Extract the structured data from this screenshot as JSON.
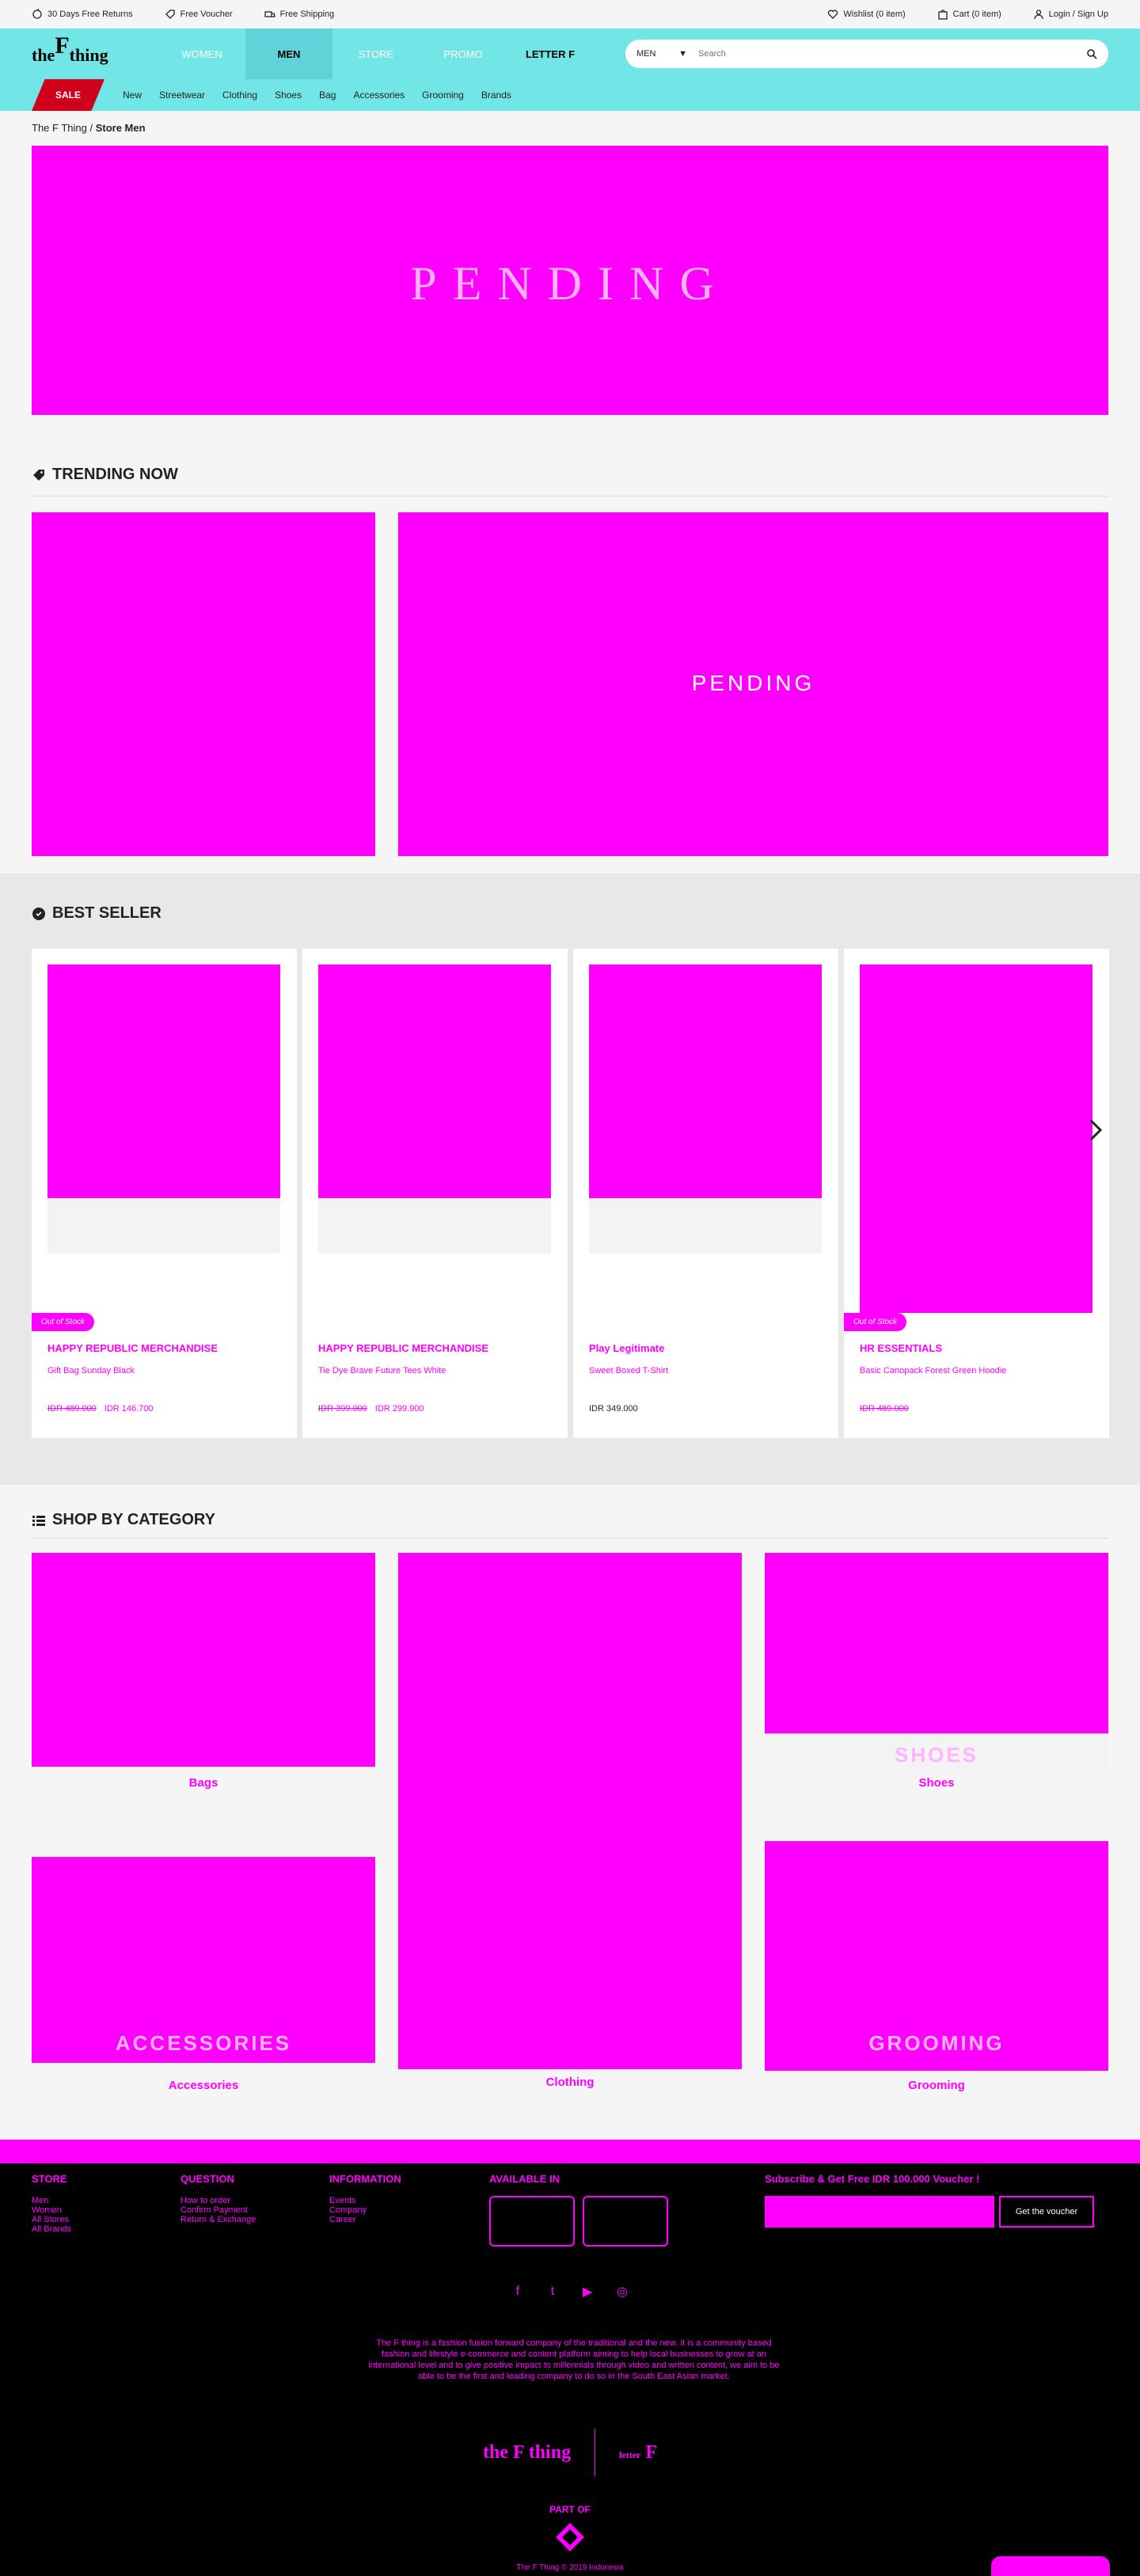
{
  "topbar": {
    "returns": "30 Days Free Returns",
    "voucher": "Free Voucher",
    "shipping": "Free Shipping",
    "wishlist": "Wishlist (0 item)",
    "cart": "Cart (0 item)",
    "login": "Login / Sign Up"
  },
  "logo": {
    "pre": "the",
    "big": "F",
    "post": "thing"
  },
  "nav": {
    "women": "WOMEN",
    "men": "MEN",
    "store": "STORE",
    "promo": "PROMO",
    "letterf": "LETTER F"
  },
  "search": {
    "select": "MEN",
    "placeholder": "Search"
  },
  "subnav": {
    "sale": "SALE",
    "items": [
      "New",
      "Streetwear",
      "Clothing",
      "Shoes",
      "Bag",
      "Accessories",
      "Grooming",
      "Brands"
    ]
  },
  "breadcrumb": {
    "home": "The F Thing",
    "sep": " / ",
    "current": "Store Men"
  },
  "banner_text": "PENDING",
  "trending": {
    "title": "TRENDING NOW",
    "promo_text": "PENDING"
  },
  "bestseller": {
    "title": "BEST SELLER",
    "products": [
      {
        "oos": "Out of Stock",
        "brand": "HAPPY REPUBLIC MERCHANDISE",
        "name": "Gift Bag Sunday Black",
        "price_old": "IDR 489.000",
        "price_new": "IDR 146.700"
      },
      {
        "oos": "",
        "brand": "HAPPY REPUBLIC MERCHANDISE",
        "name": "Tie Dye Brave Future Tees White",
        "price_old": "IDR 399.000",
        "price_new": "IDR 299.900"
      },
      {
        "oos": "",
        "brand": "Play Legitimate",
        "name": "Sweet Boxed T-Shirt",
        "price_old": "",
        "price_new": "IDR 349.000"
      },
      {
        "oos": "Out of Stock",
        "brand": "HR ESSENTIALS",
        "name": "Basic Canopack Forest Green Hoodie",
        "price_old": "IDR 489.000",
        "price_new": ""
      }
    ]
  },
  "categories": {
    "title": "SHOP BY CATEGORY",
    "bags": "Bags",
    "clothing": "Clothing",
    "shoes": "Shoes",
    "shoes_overlay": "SHOES",
    "accessories": "Accessories",
    "accessories_overlay": "ACCESSORIES",
    "grooming": "Grooming",
    "grooming_overlay": "GROOMING"
  },
  "footer": {
    "store": {
      "title": "STORE",
      "links": [
        "Men",
        "Women",
        "All Stores",
        "All Brands"
      ]
    },
    "question": {
      "title": "QUESTION",
      "links": [
        "How to order",
        "Confirm Payment",
        "Return & Exchange"
      ]
    },
    "information": {
      "title": "INFORMATION",
      "links": [
        "Events",
        "Company",
        "Career"
      ]
    },
    "available": {
      "title": "AVAILABLE IN"
    },
    "subscribe": {
      "title": "Subscribe & Get Free IDR 100.000 Voucher !",
      "button": "Get the voucher"
    },
    "description": "The F thing is a fashion fusion forward company of the traditional and the new. It is a community based fashion and lifestyle e-commerce and content platform aiming to help local businesses to grow at an international level and to give positive impact to millennials through video and written content, we aim to be able to be the first and leading company to do so in the South East Asian market.",
    "logo_letter": "letter",
    "part_of": "PART OF",
    "copyright": "The F Thing © 2019 Indonesia"
  }
}
